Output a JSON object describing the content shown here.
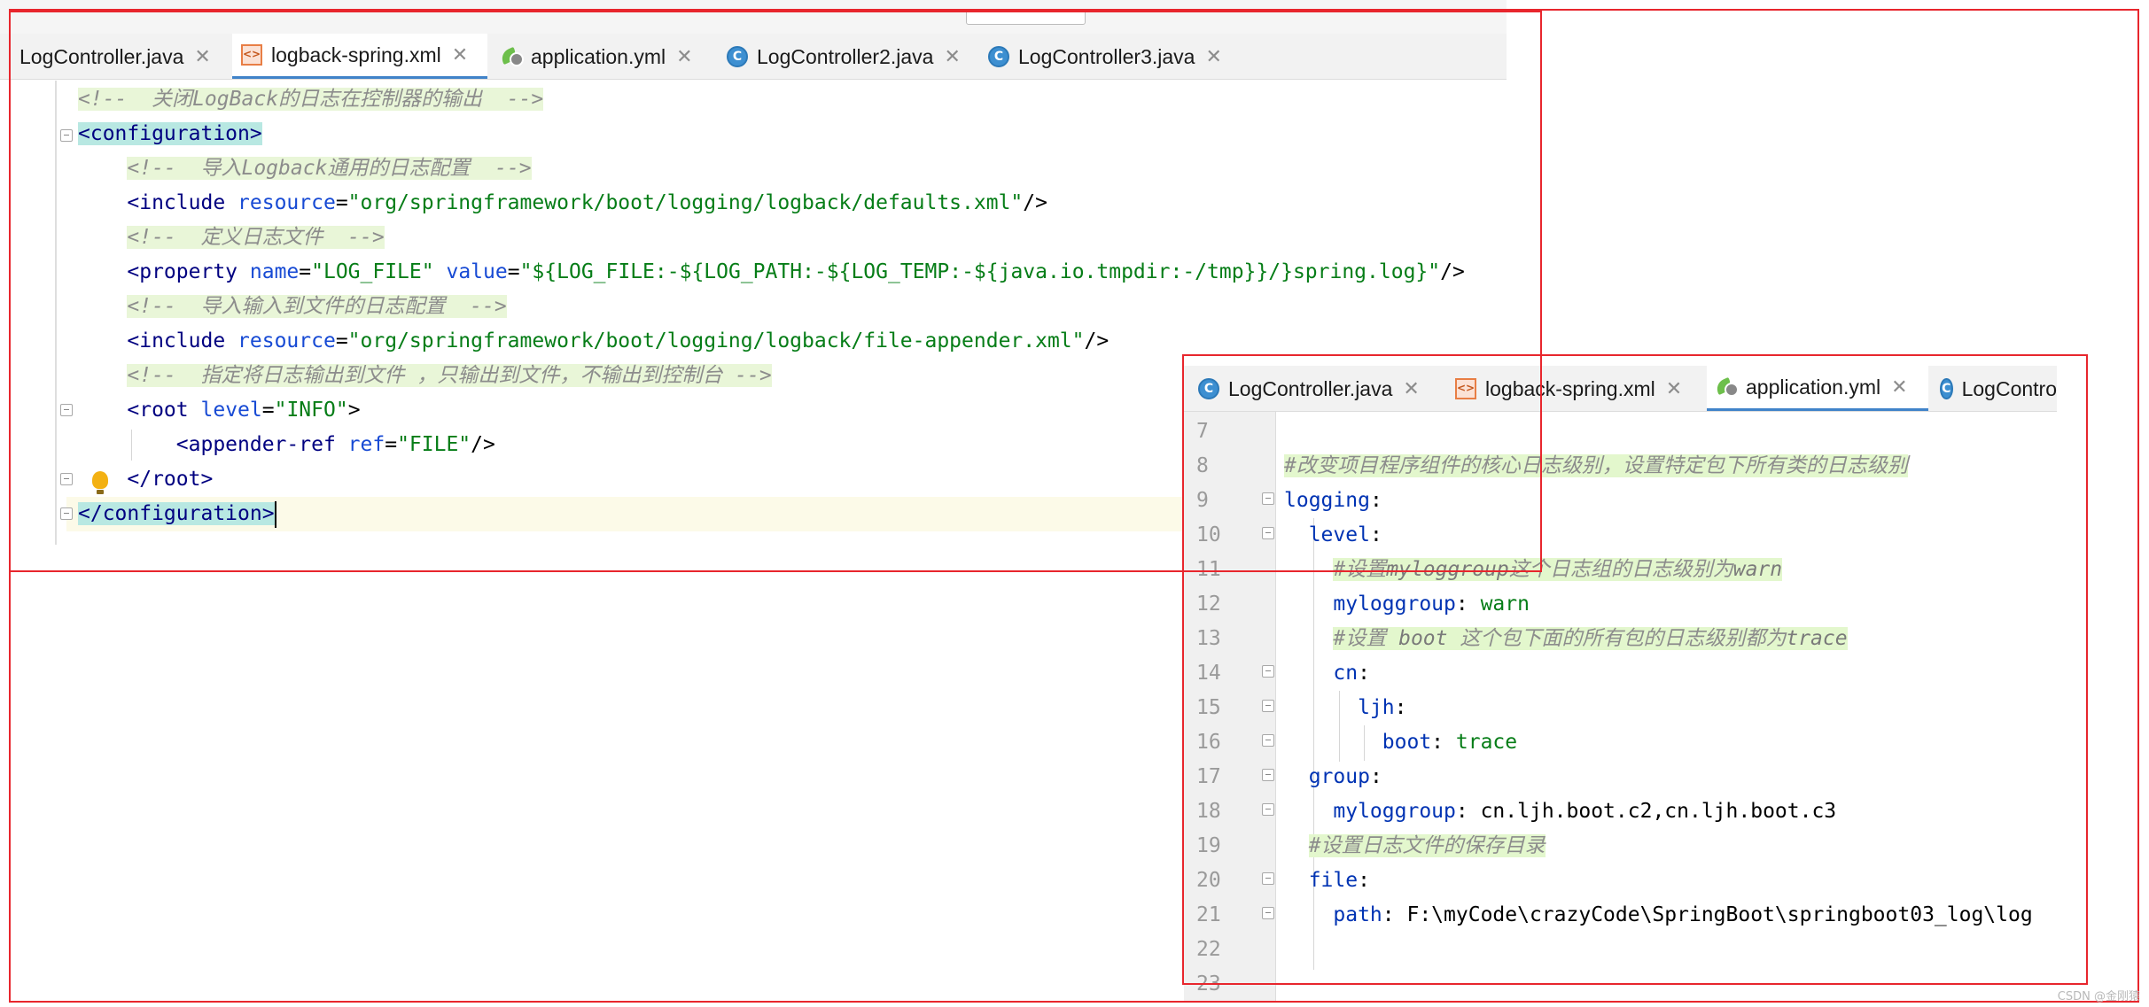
{
  "editor1": {
    "tabs": [
      {
        "label": "LogController.java",
        "icon": "java-class-icon"
      },
      {
        "label": "logback-spring.xml",
        "icon": "xml-file-icon",
        "active": true
      },
      {
        "label": "application.yml",
        "icon": "yaml-spring-icon"
      },
      {
        "label": "LogController2.java",
        "icon": "java-class-icon"
      },
      {
        "label": "LogController3.java",
        "icon": "java-class-icon"
      }
    ],
    "lines": {
      "l1_comment": "<!--  关闭LogBack的日志在控制器的输出  -->",
      "l2_open": "<configuration>",
      "l3_comment": "<!--  导入Logback通用的日志配置  -->",
      "l4_tag": "<include",
      "l4_attr": "resource",
      "l4_val": "\"org/springframework/boot/logging/logback/defaults.xml\"",
      "l5_comment": "<!--  定义日志文件  -->",
      "l6_tag": "<property",
      "l6_attr1": "name",
      "l6_val1": "\"LOG_FILE\"",
      "l6_attr2": "value",
      "l6_val2": "\"${LOG_FILE:-${LOG_PATH:-${LOG_TEMP:-${java.io.tmpdir:-/tmp}}/}spring.log}\"",
      "l7_comment": "<!--  导入输入到文件的日志配置  -->",
      "l8_tag": "<include",
      "l8_attr": "resource",
      "l8_val": "\"org/springframework/boot/logging/logback/file-appender.xml\"",
      "l9_comment": "<!--  指定将日志输出到文件 ，只输出到文件，不输出到控制台 -->",
      "l10_tag": "<root",
      "l10_attr": "level",
      "l10_val": "\"INFO\"",
      "l11_tag": "<appender-ref",
      "l11_attr": "ref",
      "l11_val": "\"FILE\"",
      "l12_close": "</root>",
      "l13_close": "</configuration>"
    }
  },
  "editor2": {
    "tabs": [
      {
        "label": "LogController.java",
        "icon": "java-class-icon"
      },
      {
        "label": "logback-spring.xml",
        "icon": "xml-file-icon"
      },
      {
        "label": "application.yml",
        "icon": "yaml-spring-icon",
        "active": true
      },
      {
        "label": "LogContro",
        "icon": "java-class-icon"
      }
    ],
    "line_numbers": [
      "7",
      "8",
      "9",
      "10",
      "11",
      "12",
      "13",
      "14",
      "15",
      "16",
      "17",
      "18",
      "19",
      "20",
      "21",
      "22",
      "23"
    ],
    "lines": {
      "l8": "#改变项目程序组件的核心日志级别，设置特定包下所有类的日志级别",
      "l9_key": "logging",
      "l10_key": "level",
      "l11_a": "#设置",
      "l11_b": "myloggroup",
      "l11_c": "这个日志组的日志级别为",
      "l11_d": "warn",
      "l12_key": "myloggroup",
      "l12_val": "warn",
      "l13_a": "#设置 ",
      "l13_b": "boot",
      "l13_c": " 这个包下面的所有包的日志级别都为",
      "l13_d": "trace",
      "l14_key": "cn",
      "l15_key": "ljh",
      "l16_key": "boot",
      "l16_val": "trace",
      "l17_key": "group",
      "l18_key": "myloggroup",
      "l18_val": "cn.ljh.boot.c2,cn.ljh.boot.c3",
      "l19": "#设置日志文件的保存目录",
      "l20_key": "file",
      "l21_key": "path",
      "l21_val": "F:\\myCode\\crazyCode\\SpringBoot\\springboot03_log\\log"
    }
  },
  "watermark": "CSDN @金刚猿",
  "colors": {
    "highlight_border": "#e8262d",
    "tab_underline": "#4083c9"
  }
}
